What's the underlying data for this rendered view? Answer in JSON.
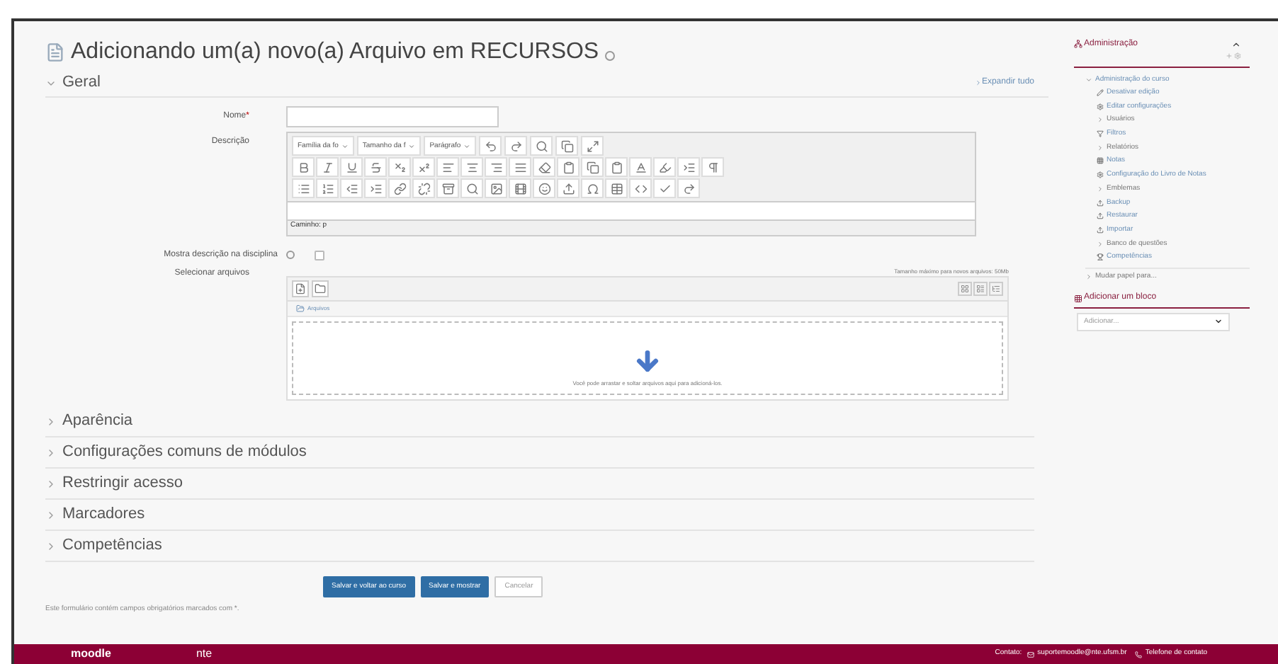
{
  "page_title": "Adicionando um(a) novo(a) Arquivo em RECURSOS",
  "expand_all": "Expandir tudo",
  "sections": [
    {
      "title": "Geral",
      "expanded": true
    },
    {
      "title": "Aparência",
      "expanded": false
    },
    {
      "title": "Configurações comuns de módulos",
      "expanded": false
    },
    {
      "title": "Restringir acesso",
      "expanded": false
    },
    {
      "title": "Marcadores",
      "expanded": false
    },
    {
      "title": "Competências",
      "expanded": false
    }
  ],
  "form": {
    "name_label": "Nome",
    "required_mark": "*",
    "description_label": "Descrição",
    "editor": {
      "selects": [
        "Família da fo",
        "Tamanho da f",
        "Parágrafo"
      ],
      "path": "Caminho: p"
    },
    "show_description": {
      "label": "Mostra descrição na disciplina",
      "checked": false
    },
    "files_label": "Selecionar arquivos",
    "max_size": "Tamanho máximo para novos arquivos: 50Mb",
    "folder": "Arquivos",
    "drop_hint": "Você pode arrastar e soltar arquivos aqui para adicioná-los."
  },
  "buttons": [
    {
      "label": "Salvar e voltar ao curso",
      "kind": "primary"
    },
    {
      "label": "Salvar e mostrar",
      "kind": "primary"
    },
    {
      "label": "Cancelar",
      "kind": "secondary"
    }
  ],
  "required_note": "Este formulário contém campos obrigatórios marcados com *.",
  "sidebar": {
    "title": "Administração",
    "root": "Administração do curso",
    "items": [
      {
        "label": "Desativar edição",
        "kind": "link"
      },
      {
        "label": "Editar configurações",
        "kind": "link"
      },
      {
        "label": "Usuários",
        "kind": "folder"
      },
      {
        "label": "Filtros",
        "kind": "link"
      },
      {
        "label": "Relatórios",
        "kind": "folder"
      },
      {
        "label": "Notas",
        "kind": "link"
      },
      {
        "label": "Configuração do Livro de Notas",
        "kind": "link"
      },
      {
        "label": "Emblemas",
        "kind": "folder"
      },
      {
        "label": "Backup",
        "kind": "link"
      },
      {
        "label": "Restaurar",
        "kind": "link"
      },
      {
        "label": "Importar",
        "kind": "link"
      },
      {
        "label": "Banco de questões",
        "kind": "folder"
      },
      {
        "label": "Competências",
        "kind": "link"
      }
    ],
    "switch_role": "Mudar papel para...",
    "add_block": "Adicionar um bloco",
    "add_select": "Adicionar..."
  },
  "footer": {
    "logo": "moodle",
    "logo2": "nte",
    "contact": "Contato:",
    "email": "suportemoodle@nte.ufsm.br",
    "phone": "Telefone de contato"
  }
}
